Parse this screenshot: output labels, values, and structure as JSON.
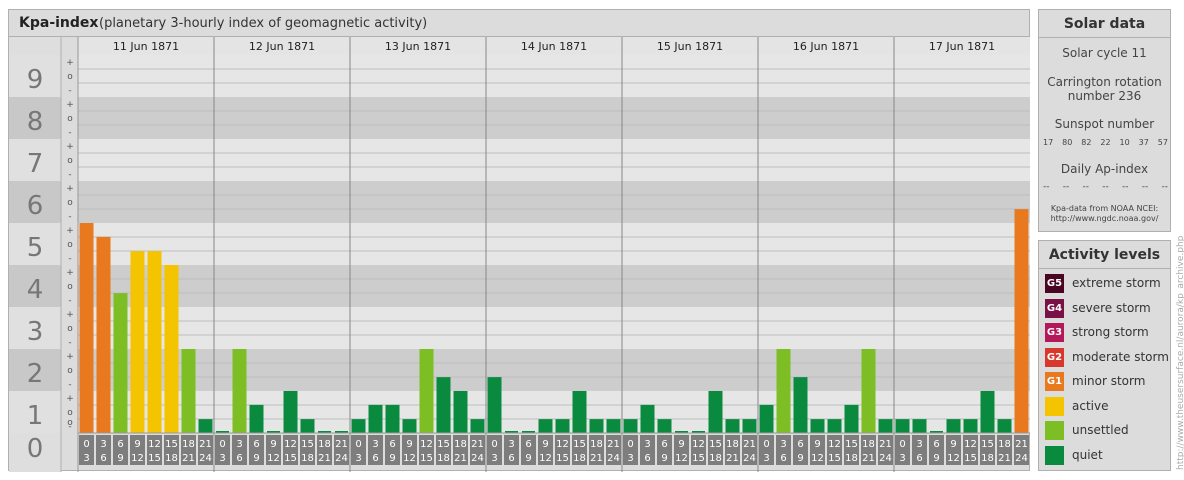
{
  "header": {
    "title": "Kpa-index",
    "subtitle": "(planetary 3-hourly index of geomagnetic activity)"
  },
  "chart_data": {
    "type": "bar",
    "ylim": [
      0,
      9
    ],
    "y_ticks": [
      "0",
      "1",
      "2",
      "3",
      "4",
      "5",
      "6",
      "7",
      "8",
      "9"
    ],
    "minor_marks": [
      "+",
      "o",
      "-"
    ],
    "days": [
      "11 Jun 1871",
      "12 Jun 1871",
      "13 Jun 1871",
      "14 Jun 1871",
      "15 Jun 1871",
      "16 Jun 1871",
      "17 Jun 1871"
    ],
    "interval_labels": [
      [
        "0",
        "3"
      ],
      [
        "3",
        "6"
      ],
      [
        "6",
        "9"
      ],
      [
        "9",
        "12"
      ],
      [
        "12",
        "15"
      ],
      [
        "15",
        "18"
      ],
      [
        "18",
        "21"
      ],
      [
        "21",
        "24"
      ]
    ],
    "values": [
      [
        5.0,
        4.67,
        3.33,
        4.33,
        4.33,
        4.0,
        2.0,
        0.33
      ],
      [
        0.0,
        2.0,
        0.67,
        0.0,
        1.0,
        0.33,
        0.0,
        0.0
      ],
      [
        0.33,
        0.67,
        0.67,
        0.33,
        2.0,
        1.33,
        1.0,
        0.33
      ],
      [
        1.33,
        0.0,
        0.0,
        0.33,
        0.33,
        1.0,
        0.33,
        0.33
      ],
      [
        0.33,
        0.67,
        0.33,
        0.0,
        0.0,
        1.0,
        0.33,
        0.33
      ],
      [
        0.67,
        2.0,
        1.33,
        0.33,
        0.33,
        0.67,
        2.0,
        0.33
      ],
      [
        0.33,
        0.33,
        0.0,
        0.33,
        0.33,
        1.0,
        0.33,
        5.33
      ]
    ],
    "colors": {
      "quiet": "#0a8a3e",
      "unsettled": "#7cbe24",
      "active": "#f5c400",
      "minor_storm": "#e8791e",
      "moderate_storm": "#d8382c",
      "strong_storm": "#b3195a",
      "severe_storm": "#7a1045",
      "extreme_storm": "#4a0522"
    }
  },
  "solar": {
    "heading": "Solar data",
    "cycle": "Solar cycle 11",
    "carrington_line1": "Carrington rotation",
    "carrington_line2": "number 236",
    "sunspot_heading": "Sunspot number",
    "sunspot_values": [
      "17",
      "80",
      "82",
      "22",
      "10",
      "37",
      "57"
    ],
    "ap_heading": "Daily Ap-index",
    "ap_values": [
      "--",
      "--",
      "--",
      "--",
      "--",
      "--",
      "--"
    ],
    "source_line1": "Kpa-data from NOAA NCEI:",
    "source_line2": "http://www.ngdc.noaa.gov/"
  },
  "activity": {
    "heading": "Activity levels",
    "items": [
      {
        "code": "G5",
        "label": "extreme storm",
        "color": "#4a0522"
      },
      {
        "code": "G4",
        "label": "severe storm",
        "color": "#7a1045"
      },
      {
        "code": "G3",
        "label": "strong storm",
        "color": "#b3195a"
      },
      {
        "code": "G2",
        "label": "moderate storm",
        "color": "#d8382c"
      },
      {
        "code": "G1",
        "label": "minor storm",
        "color": "#e8791e"
      },
      {
        "code": "",
        "label": "active",
        "color": "#f5c400"
      },
      {
        "code": "",
        "label": "unsettled",
        "color": "#7cbe24"
      },
      {
        "code": "",
        "label": "quiet",
        "color": "#0a8a3e"
      }
    ]
  },
  "credit": "http://www.theusersurface.nl/aurora/kp_archive.php"
}
